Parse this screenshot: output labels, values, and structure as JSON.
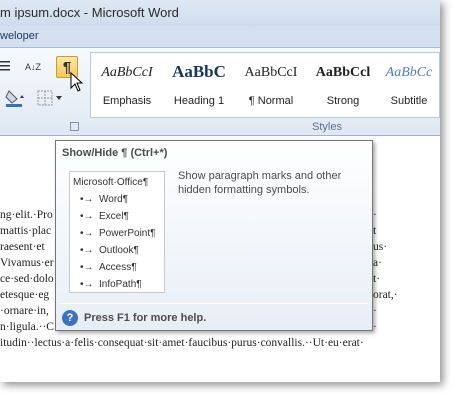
{
  "window": {
    "title": "m ipsum.docx - Microsoft Word",
    "tab_partial": "weloper"
  },
  "ribbon": {
    "pilcrow_glyph": "¶",
    "sort_glyph": "A↓Z",
    "group_label": "Styles",
    "styles": [
      {
        "sample": "AaBbCcI",
        "label": "Emphasis"
      },
      {
        "sample": "AaBbC",
        "label": "Heading 1"
      },
      {
        "sample": "AaBbCcI",
        "label": "¶ Normal"
      },
      {
        "sample": "AaBbCcl",
        "label": "Strong"
      },
      {
        "sample": "AaBbCc",
        "label": "Subtitle"
      }
    ]
  },
  "tooltip": {
    "title": "Show/Hide ¶ (Ctrl+*)",
    "description": "Show paragraph marks and other hidden formatting symbols.",
    "preview": {
      "heading": "Microsoft·Office¶",
      "items": [
        "Word¶",
        "Excel¶",
        "PowerPoint¶",
        "Outlook¶",
        "Access¶",
        "InfoPath¶"
      ],
      "bullet": "•→"
    },
    "help_icon": "?",
    "help_text": "Press F1 for more help."
  },
  "document": {
    "lines": [
      "ng·elit.·Pro",
      "mattis·plac",
      "raesent·et",
      "Vivamus·er",
      "ce·sed·dolo",
      "etesque·eg",
      "·ornare·in,",
      "n·ligula.··C",
      "itudin··lectus·a·felis·consequat·sit·amet·faucibus·purus·convallis.··Ut·eu·erat·"
    ],
    "right_fragments": [
      {
        "line": 0,
        "text": "·"
      },
      {
        "line": 1,
        "text": "t"
      },
      {
        "line": 2,
        "text": "us·"
      },
      {
        "line": 3,
        "text": "a·"
      },
      {
        "line": 4,
        "text": "t·"
      },
      {
        "line": 5,
        "text": "orat,·"
      },
      {
        "line": 6,
        "text": "·"
      },
      {
        "line": 7,
        "text": "·"
      }
    ]
  },
  "colors": {
    "accent": "#3b73c4",
    "pilcrow_button": "#f6c658",
    "heading_blue": "#17365d",
    "subtitle_blue": "#4f81bd"
  }
}
